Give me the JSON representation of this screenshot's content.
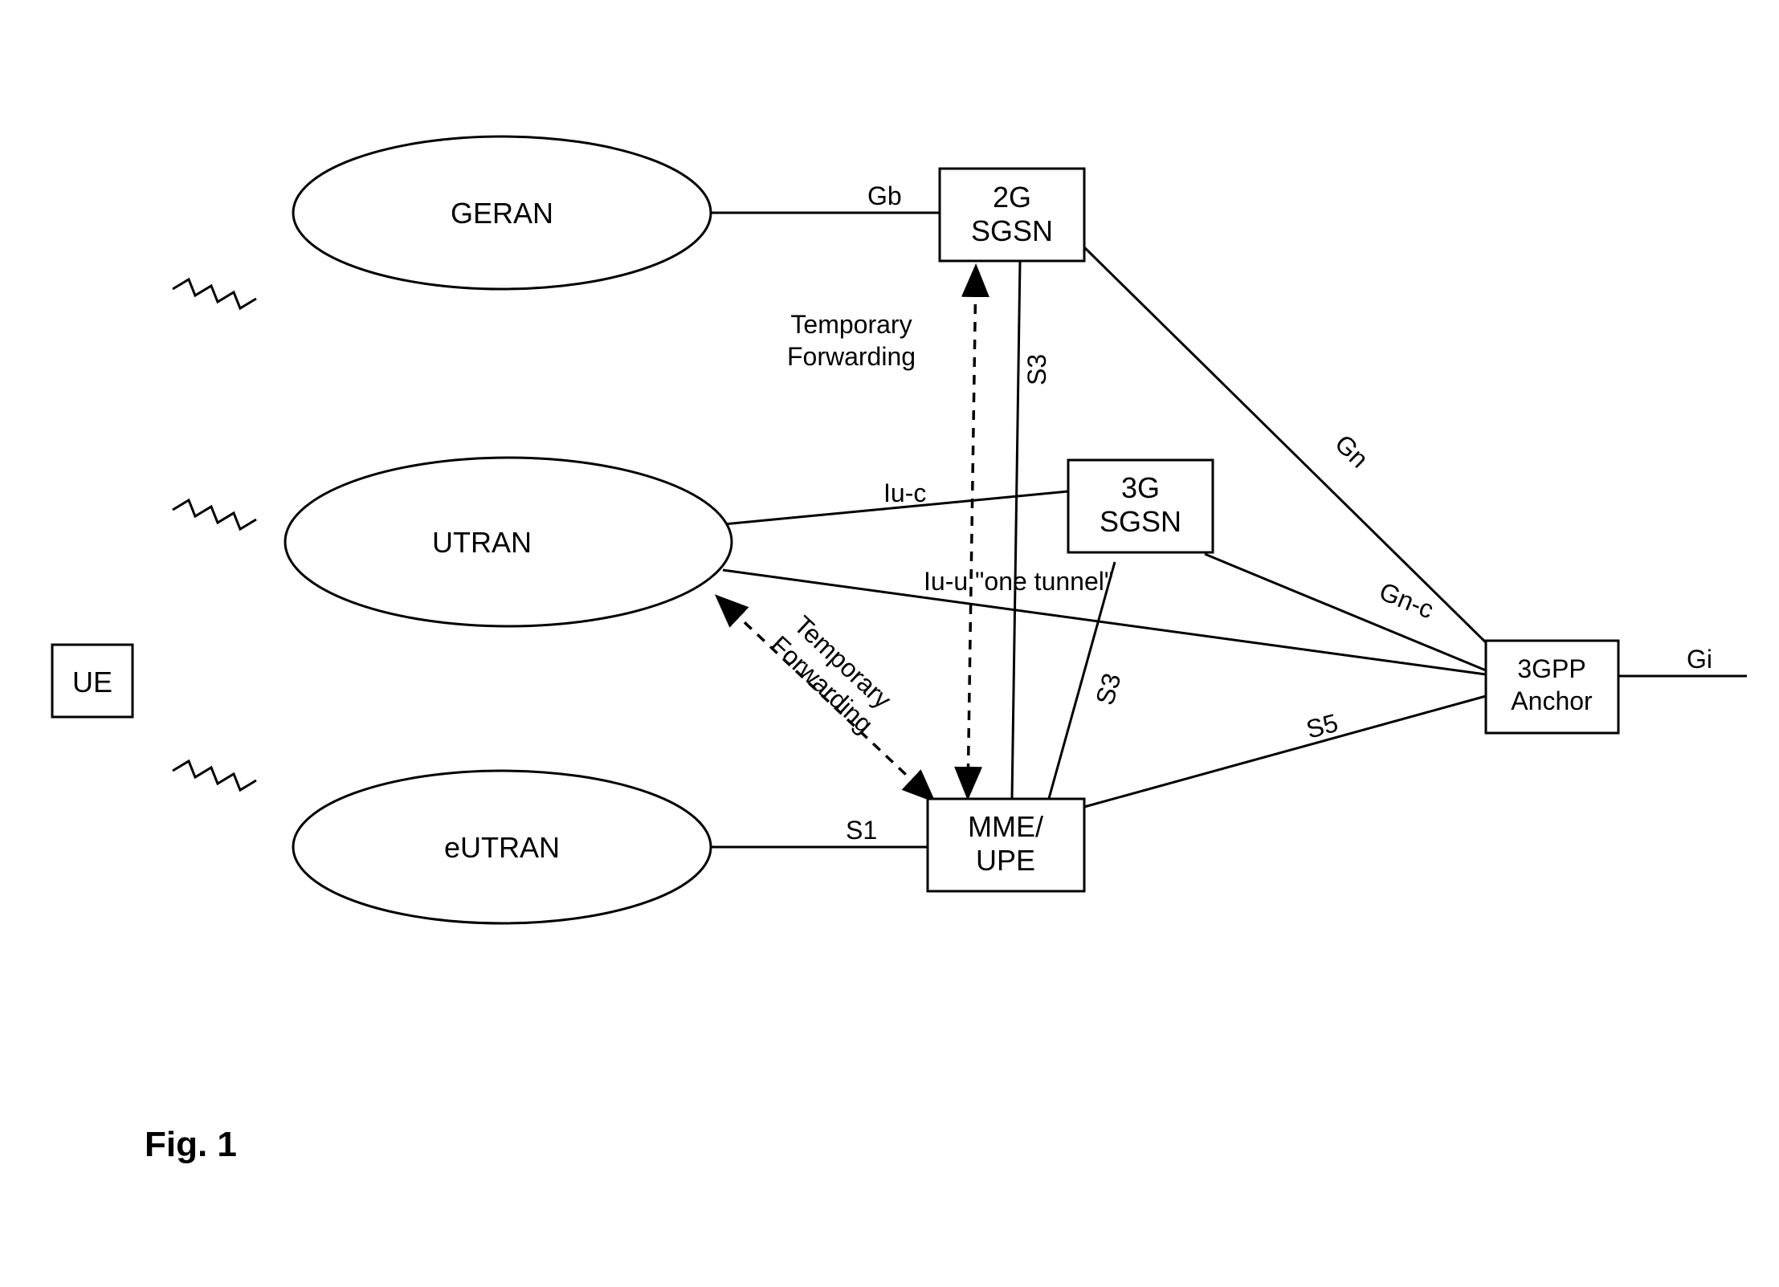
{
  "nodes": {
    "ue": "UE",
    "geran": "GERAN",
    "utran": "UTRAN",
    "eutran": "eUTRAN",
    "sgsn2g_1": "2G",
    "sgsn2g_2": "SGSN",
    "sgsn3g_1": "3G",
    "sgsn3g_2": "SGSN",
    "mme_1": "MME/",
    "mme_2": "UPE",
    "anchor_1": "3GPP",
    "anchor_2": "Anchor"
  },
  "edges": {
    "gb": "Gb",
    "iuc": "Iu-c",
    "iuu": "Iu-u \"one tunnel\"",
    "s1": "S1",
    "s3a": "S3",
    "s3b": "S3",
    "gn": "Gn",
    "gnc": "Gn-c",
    "s5": "S5",
    "gi": "Gi",
    "tempfwd1a": "Temporary",
    "tempfwd1b": "Forwarding",
    "tempfwd2a": "Temporary",
    "tempfwd2b": "Forwarding"
  },
  "figure": "Fig. 1"
}
